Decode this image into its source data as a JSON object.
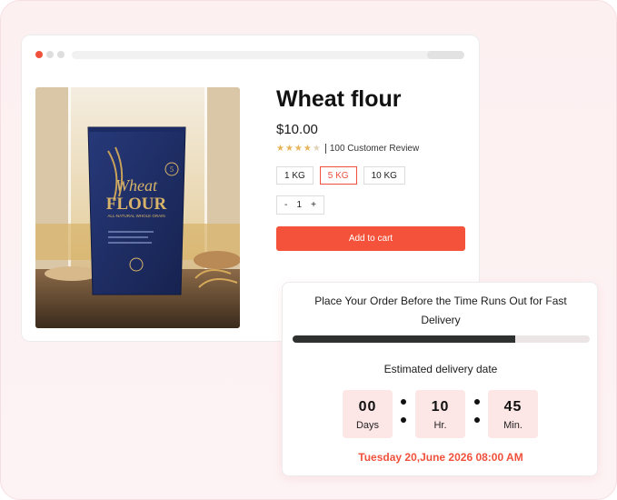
{
  "product": {
    "title": "Wheat flour",
    "price": "$10.00",
    "rating_value": 4.5,
    "rating_max": 5,
    "review_text": "100 Customer Review",
    "package_text": {
      "line1": "Wheat",
      "line2": "FLOUR",
      "tagline": "ALL-NATURAL WHOLE GRAIN",
      "badge": "5"
    },
    "sizes": [
      {
        "label": "1 KG",
        "selected": false
      },
      {
        "label": "5 KG",
        "selected": true
      },
      {
        "label": "10 KG",
        "selected": false
      }
    ],
    "quantity": {
      "minus": "-",
      "value": "1",
      "plus": "+"
    },
    "add_to_cart_label": "Add to cart"
  },
  "delivery": {
    "heading": "Place Your Order Before the Time Runs Out for Fast Delivery",
    "progress_fraction": 0.75,
    "estimated_label": "Estimated delivery date",
    "countdown": [
      {
        "value": "00",
        "unit": "Days"
      },
      {
        "value": "10",
        "unit": "Hr."
      },
      {
        "value": "45",
        "unit": "Min."
      }
    ],
    "date_text": "Tuesday 20,June 2026 08:00 AM"
  },
  "colors": {
    "accent": "#f0513c",
    "button": "#f4523a",
    "progress_fill": "#2f3030",
    "timer_bg": "#fde6e6",
    "star": "#e9b35a"
  }
}
